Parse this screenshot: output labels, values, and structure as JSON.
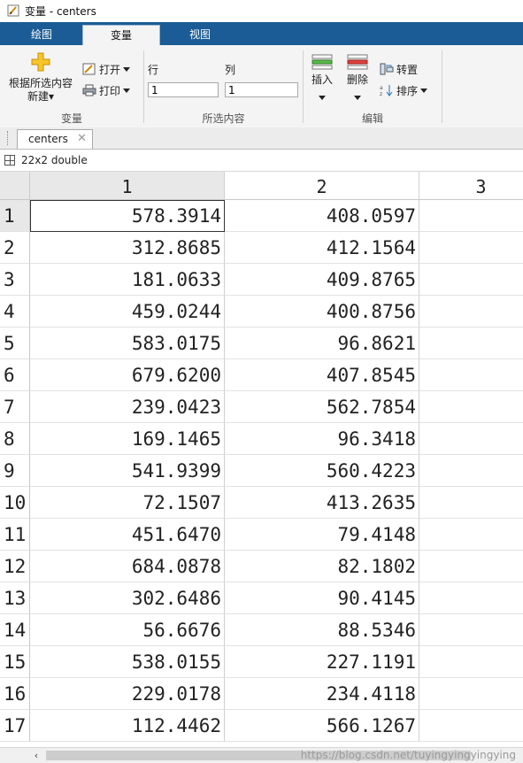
{
  "window": {
    "title": "变量 - centers"
  },
  "ribbon_tabs": [
    {
      "label": "绘图"
    },
    {
      "label": "变量"
    },
    {
      "label": "视图"
    }
  ],
  "ribbon": {
    "variable_group": {
      "new_from_selection": "根据所选内容",
      "new_from_selection_2": "新建▾",
      "open": "打开",
      "print": "打印",
      "label": "变量"
    },
    "selection_group": {
      "row_label": "行",
      "col_label": "列",
      "row_value": "1",
      "col_value": "1",
      "label": "所选内容"
    },
    "edit_group": {
      "insert": "插入",
      "delete": "删除",
      "transpose": "转置",
      "sort": "排序",
      "label": "编辑"
    }
  },
  "doc_tab": {
    "name": "centers",
    "close": "✕"
  },
  "variable_info": "22x2 double",
  "table": {
    "columns": [
      "1",
      "2",
      "3"
    ],
    "rows": [
      {
        "idx": "1",
        "c1": "578.3914",
        "c2": "408.0597"
      },
      {
        "idx": "2",
        "c1": "312.8685",
        "c2": "412.1564"
      },
      {
        "idx": "3",
        "c1": "181.0633",
        "c2": "409.8765"
      },
      {
        "idx": "4",
        "c1": "459.0244",
        "c2": "400.8756"
      },
      {
        "idx": "5",
        "c1": "583.0175",
        "c2": "96.8621"
      },
      {
        "idx": "6",
        "c1": "679.6200",
        "c2": "407.8545"
      },
      {
        "idx": "7",
        "c1": "239.0423",
        "c2": "562.7854"
      },
      {
        "idx": "8",
        "c1": "169.1465",
        "c2": "96.3418"
      },
      {
        "idx": "9",
        "c1": "541.9399",
        "c2": "560.4223"
      },
      {
        "idx": "10",
        "c1": "72.1507",
        "c2": "413.2635"
      },
      {
        "idx": "11",
        "c1": "451.6470",
        "c2": "79.4148"
      },
      {
        "idx": "12",
        "c1": "684.0878",
        "c2": "82.1802"
      },
      {
        "idx": "13",
        "c1": "302.6486",
        "c2": "90.4145"
      },
      {
        "idx": "14",
        "c1": "56.6676",
        "c2": "88.5346"
      },
      {
        "idx": "15",
        "c1": "538.0155",
        "c2": "227.1191"
      },
      {
        "idx": "16",
        "c1": "229.0178",
        "c2": "234.4118"
      },
      {
        "idx": "17",
        "c1": "112.4462",
        "c2": "566.1267"
      }
    ]
  },
  "scrollbar": {
    "left_arrow": "‹"
  },
  "watermark": "https://blog.csdn.net/tuyingyingyingying"
}
